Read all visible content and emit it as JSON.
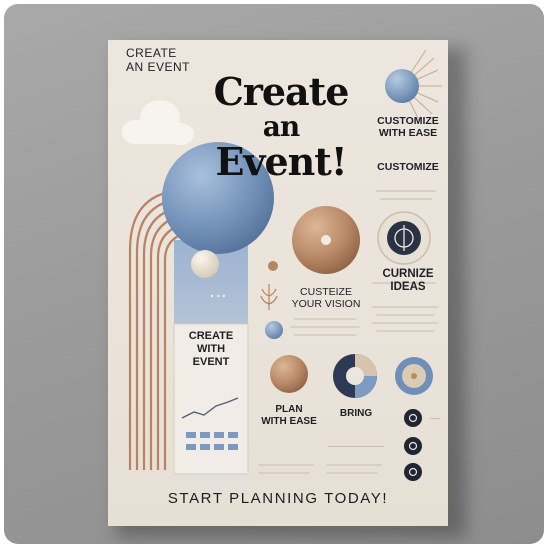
{
  "poster": {
    "corner_title": [
      "CREATE",
      "AN EVENT"
    ],
    "headline": [
      "Create",
      "an",
      "Event!"
    ],
    "side_heading_1": [
      "CUSTOMIZE",
      "WITH EASE"
    ],
    "side_heading_2": "CUSTOMIZE",
    "side_heading_3": [
      "CURNIZE",
      "IDEAS"
    ],
    "mid_heading": [
      "CUSTEIZE",
      "YOUR VISION"
    ],
    "card_heading": [
      "CREATE",
      "WITH",
      "EVENT"
    ],
    "plan_heading": [
      "PLAN",
      "WITH EASE"
    ],
    "bring_heading": "BRING",
    "footer": "START PLANNING TODAY!",
    "colors": {
      "navy": "#25344a",
      "blue": "#6f8fb8",
      "tan": "#b98a67",
      "cream": "#ece6de"
    },
    "icons": [
      "compass-icon",
      "leaf-sprig-icon",
      "sun-icon",
      "cloud-icon",
      "pie-chart-icon"
    ]
  }
}
